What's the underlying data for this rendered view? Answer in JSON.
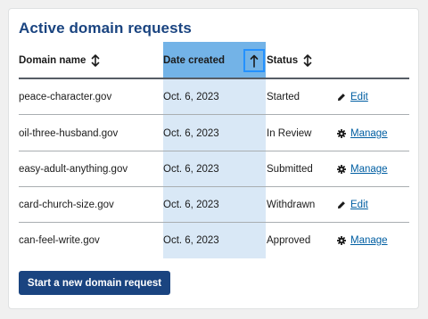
{
  "title": "Active domain requests",
  "columns": {
    "domain": "Domain name",
    "date": "Date created",
    "status": "Status"
  },
  "rows": [
    {
      "domain": "peace-character.gov",
      "date": "Oct. 6, 2023",
      "status": "Started",
      "action": "Edit",
      "action_icon": "pencil-icon"
    },
    {
      "domain": "oil-three-husband.gov",
      "date": "Oct. 6, 2023",
      "status": "In Review",
      "action": "Manage",
      "action_icon": "gear-icon"
    },
    {
      "domain": "easy-adult-anything.gov",
      "date": "Oct. 6, 2023",
      "status": "Submitted",
      "action": "Manage",
      "action_icon": "gear-icon"
    },
    {
      "domain": "card-church-size.gov",
      "date": "Oct. 6, 2023",
      "status": "Withdrawn",
      "action": "Edit",
      "action_icon": "pencil-icon"
    },
    {
      "domain": "can-feel-write.gov",
      "date": "Oct. 6, 2023",
      "status": "Approved",
      "action": "Manage",
      "action_icon": "gear-icon"
    }
  ],
  "sorted_column": "date",
  "sort_direction": "ascending",
  "new_request_button": "Start a new domain request",
  "colors": {
    "title": "#1a4480",
    "link": "#005ea2",
    "sorted_header": "#73b3e7",
    "sorted_column": "#d9e8f6",
    "focus_outline": "#2491ff",
    "button": "#1a4480"
  }
}
